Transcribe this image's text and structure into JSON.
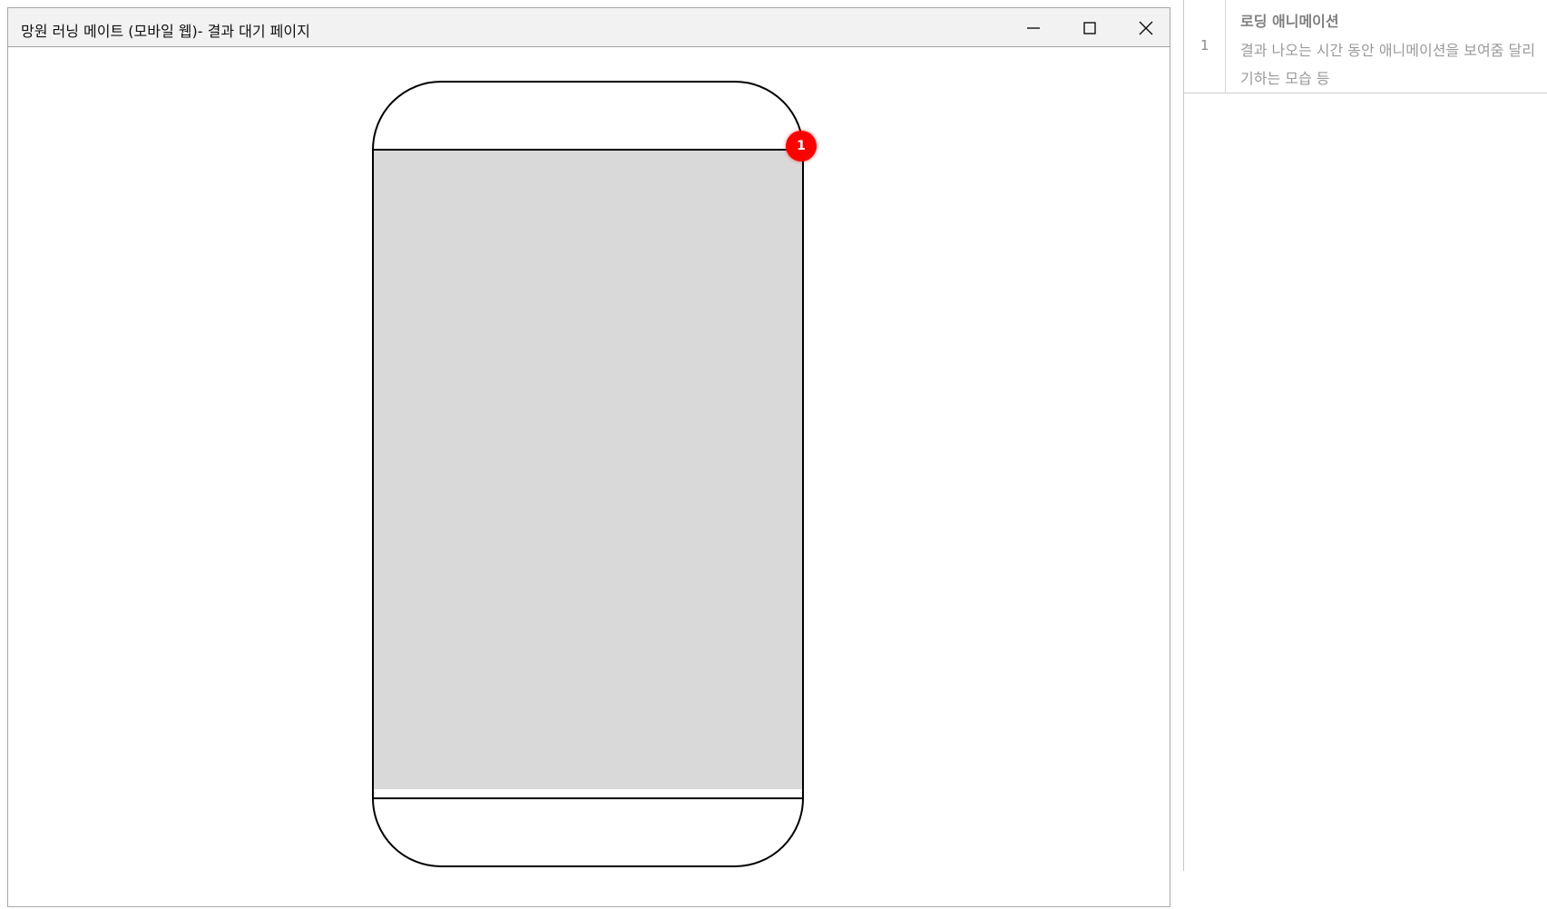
{
  "window": {
    "title": "망원 러닝 메이트 (모바일 웹)- 결과 대기 페이지"
  },
  "marker": {
    "number": "1",
    "color": "#ff0000"
  },
  "screen": {
    "fill_color": "#d9d9d9"
  },
  "notes": [
    {
      "number": "1",
      "title": "로딩 애니메이션",
      "description": "결과 나오는 시간 동안 애니메이션을 보여줌 달리기하는 모습 등"
    }
  ]
}
